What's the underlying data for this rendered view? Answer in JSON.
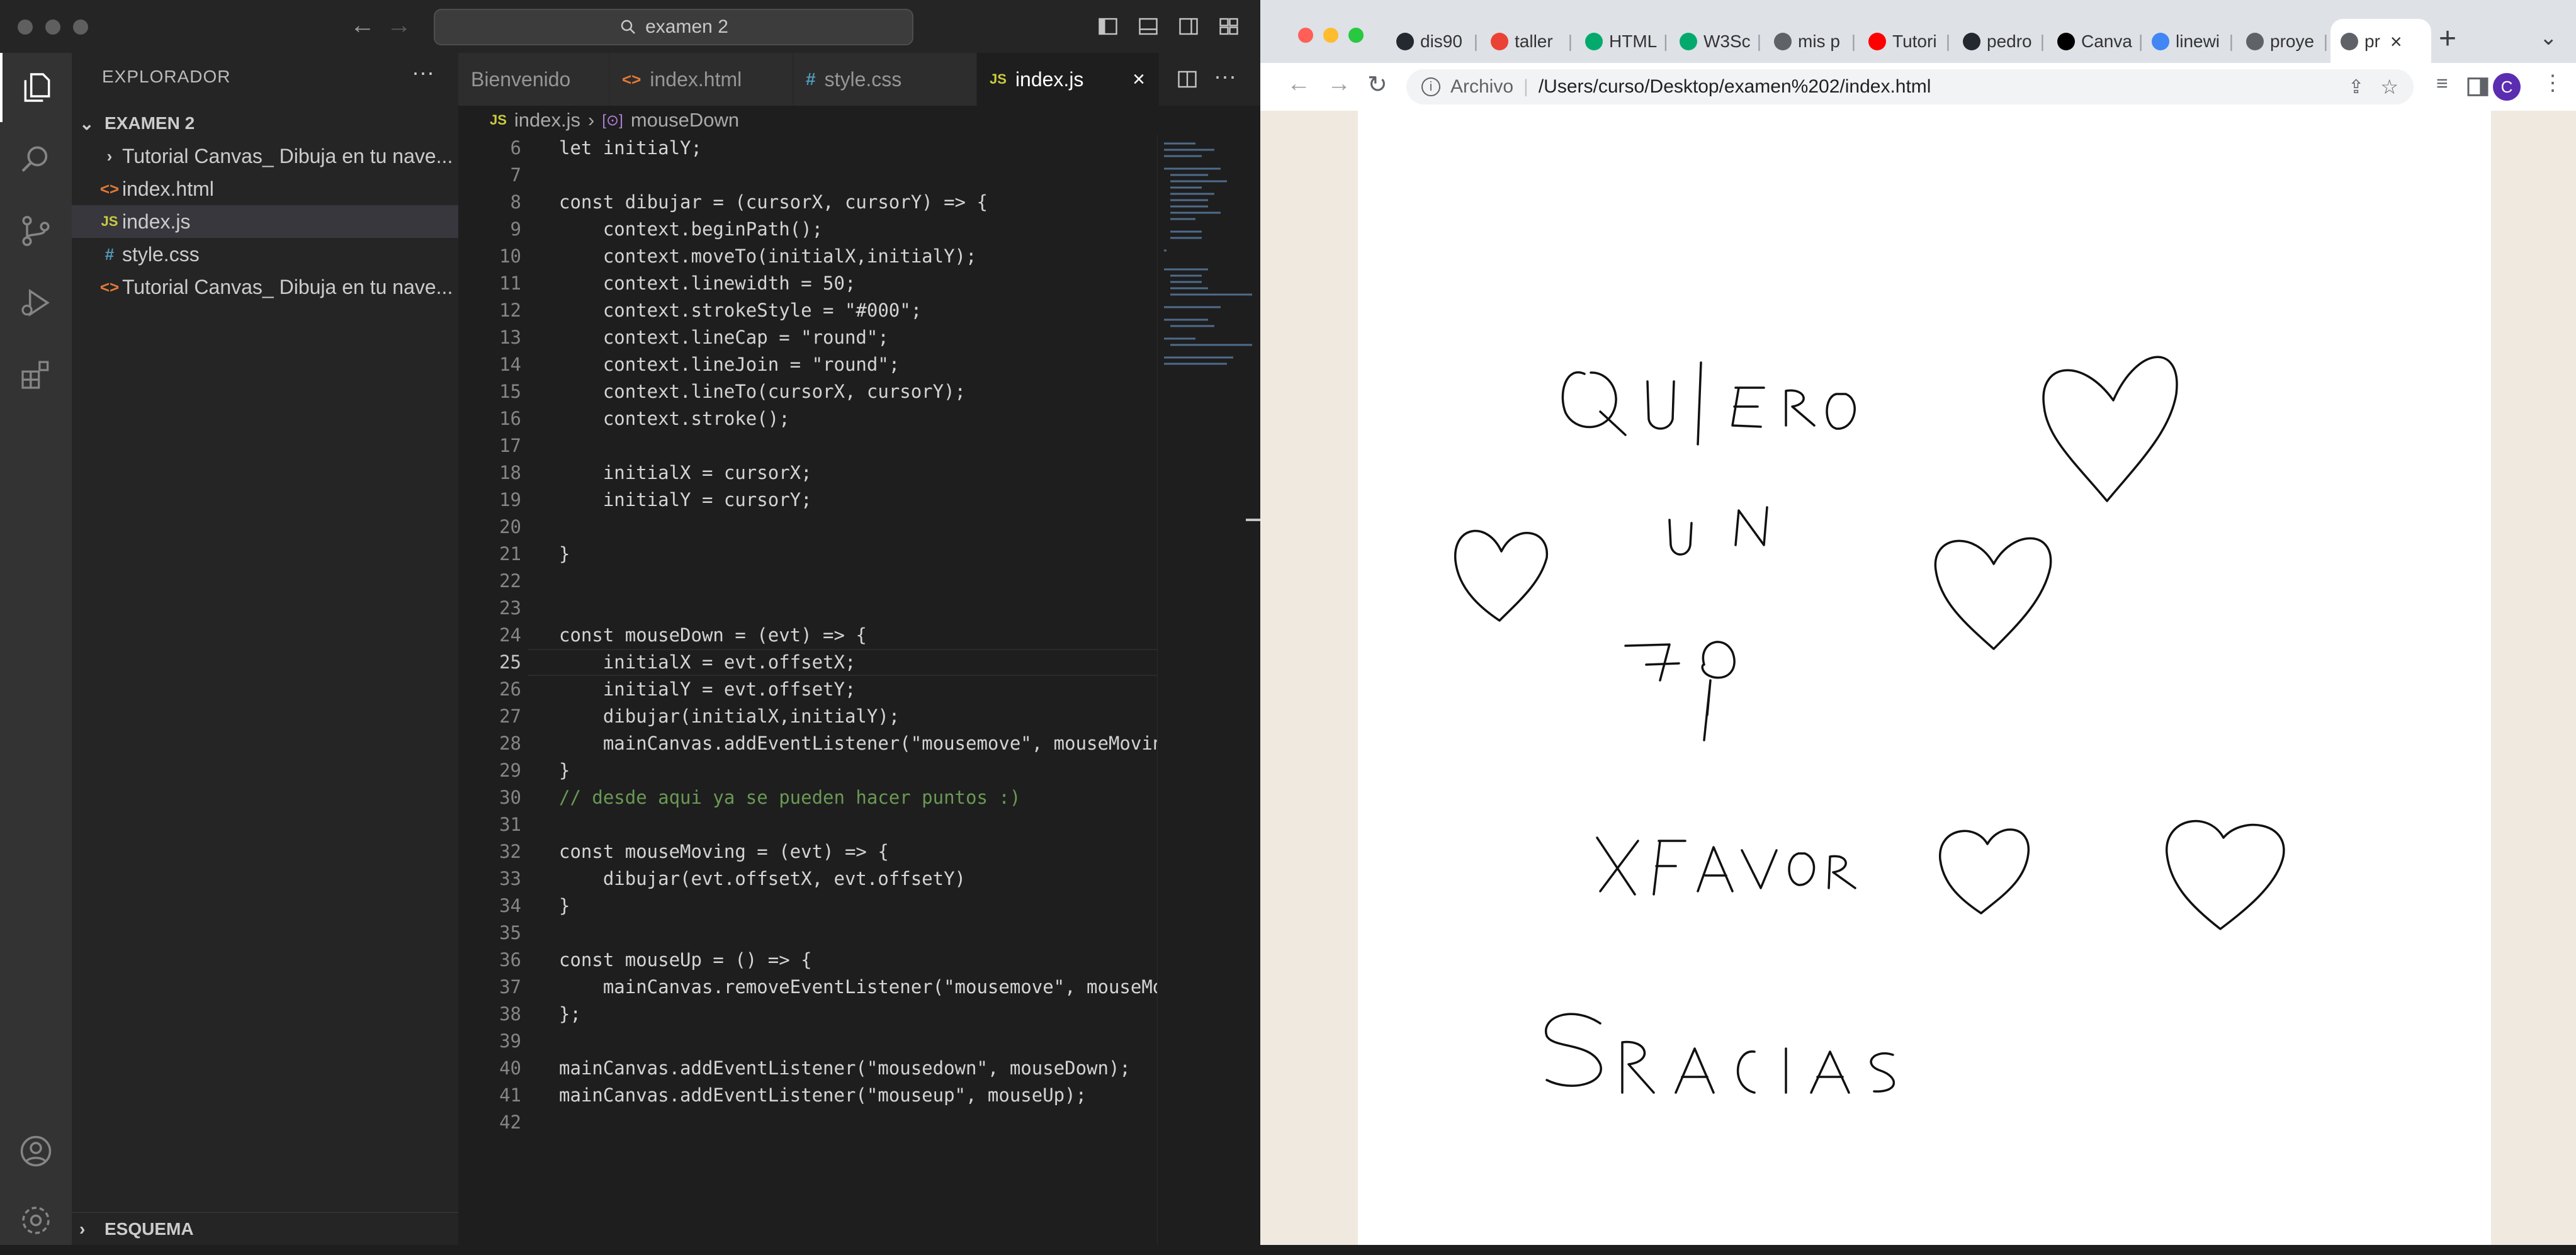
{
  "vscode": {
    "search_text": "examen 2",
    "sidebar": {
      "title": "EXPLORADOR",
      "folder": "EXAMEN 2",
      "items": [
        {
          "label": "Tutorial Canvas_ Dibuja en tu nave...",
          "icon": "chevron-right-icon",
          "type": "folder"
        },
        {
          "label": "index.html",
          "icon": "html-file-icon",
          "type": "html"
        },
        {
          "label": "index.js",
          "icon": "js-file-icon",
          "type": "js",
          "selected": true
        },
        {
          "label": "style.css",
          "icon": "css-file-icon",
          "type": "css"
        },
        {
          "label": "Tutorial Canvas_ Dibuja en tu nave...",
          "icon": "html-file-icon",
          "type": "html"
        }
      ],
      "outline_label": "ESQUEMA"
    },
    "tabs": [
      {
        "label": "Bienvenido",
        "active": false
      },
      {
        "label": "index.html",
        "icon": "html-file-icon",
        "active": false
      },
      {
        "label": "style.css",
        "icon": "css-file-icon",
        "active": false
      },
      {
        "label": "index.js",
        "icon": "js-file-icon",
        "active": true
      }
    ],
    "breadcrumbs": {
      "file": "index.js",
      "symbol": "mouseDown"
    },
    "cursor_line": 25,
    "code_lines": [
      {
        "n": "6",
        "t": "let initialY;"
      },
      {
        "n": "7",
        "t": ""
      },
      {
        "n": "8",
        "t": "const dibujar = (cursorX, cursorY) => {"
      },
      {
        "n": "9",
        "t": "    context.beginPath();"
      },
      {
        "n": "10",
        "t": "    context.moveTo(initialX,initialY);"
      },
      {
        "n": "11",
        "t": "    context.linewidth = 50;"
      },
      {
        "n": "12",
        "t": "    context.strokeStyle = \"#000\";"
      },
      {
        "n": "13",
        "t": "    context.lineCap = \"round\";"
      },
      {
        "n": "14",
        "t": "    context.lineJoin = \"round\";"
      },
      {
        "n": "15",
        "t": "    context.lineTo(cursorX, cursorY);"
      },
      {
        "n": "16",
        "t": "    context.stroke();"
      },
      {
        "n": "17",
        "t": ""
      },
      {
        "n": "18",
        "t": "    initialX = cursorX;"
      },
      {
        "n": "19",
        "t": "    initialY = cursorY;"
      },
      {
        "n": "20",
        "t": ""
      },
      {
        "n": "21",
        "t": "}"
      },
      {
        "n": "22",
        "t": ""
      },
      {
        "n": "23",
        "t": ""
      },
      {
        "n": "24",
        "t": "const mouseDown = (evt) => {"
      },
      {
        "n": "25",
        "t": "    initialX = evt.offsetX;"
      },
      {
        "n": "26",
        "t": "    initialY = evt.offsetY;"
      },
      {
        "n": "27",
        "t": "    dibujar(initialX,initialY);"
      },
      {
        "n": "28",
        "t": "    mainCanvas.addEventListener(\"mousemove\", mouseMovin"
      },
      {
        "n": "29",
        "t": "}"
      },
      {
        "n": "30",
        "t": "// desde aqui ya se pueden hacer puntos :)"
      },
      {
        "n": "31",
        "t": ""
      },
      {
        "n": "32",
        "t": "const mouseMoving = (evt) => {"
      },
      {
        "n": "33",
        "t": "    dibujar(evt.offsetX, evt.offsetY)"
      },
      {
        "n": "34",
        "t": "}"
      },
      {
        "n": "35",
        "t": ""
      },
      {
        "n": "36",
        "t": "const mouseUp = () => {"
      },
      {
        "n": "37",
        "t": "    mainCanvas.removeEventListener(\"mousemove\", mouseMo"
      },
      {
        "n": "38",
        "t": "};"
      },
      {
        "n": "39",
        "t": ""
      },
      {
        "n": "40",
        "t": "mainCanvas.addEventListener(\"mousedown\", mouseDown);"
      },
      {
        "n": "41",
        "t": "mainCanvas.addEventListener(\"mouseup\", mouseUp);"
      },
      {
        "n": "42",
        "t": ""
      }
    ]
  },
  "browser": {
    "tabs": [
      {
        "label": "dis90",
        "icon": "github-icon",
        "color": "#24292f"
      },
      {
        "label": "taller",
        "icon": "gmail-icon",
        "color": "#ea4335"
      },
      {
        "label": "HTML",
        "icon": "w3schools-icon",
        "color": "#04aa6d"
      },
      {
        "label": "W3Sc",
        "icon": "w3schools-icon",
        "color": "#04aa6d"
      },
      {
        "label": "mis p",
        "icon": "globe-icon",
        "color": "#5f6368"
      },
      {
        "label": "Tutori",
        "icon": "youtube-icon",
        "color": "#ff0000"
      },
      {
        "label": "pedro",
        "icon": "github-icon",
        "color": "#24292f"
      },
      {
        "label": "Canva",
        "icon": "medium-icon",
        "color": "#000000"
      },
      {
        "label": "linewi",
        "icon": "google-icon",
        "color": "#4285f4"
      },
      {
        "label": "proye",
        "icon": "globe-icon",
        "color": "#5f6368"
      },
      {
        "label": "pr",
        "icon": "globe-icon",
        "color": "#5f6368",
        "active": true
      }
    ],
    "address": {
      "prefix": "Archivo",
      "url": "/Users/curso/Desktop/examen%202/index.html"
    },
    "profile_initial": "C",
    "colors": {
      "ink": "#000000",
      "canvas": "#ffffff",
      "page_bg": "#f0e9e0",
      "profile": "#5b2db0"
    }
  }
}
